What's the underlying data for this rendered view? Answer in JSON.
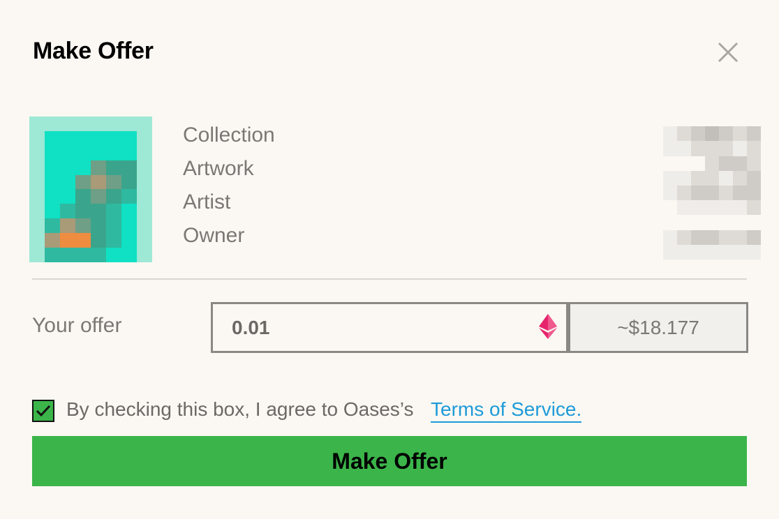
{
  "modal": {
    "title": "Make Offer",
    "close_icon": "close-icon"
  },
  "details": {
    "labels": [
      "Collection",
      "Artwork",
      "Artist",
      "Owner"
    ]
  },
  "offer": {
    "label": "Your offer",
    "value": "0.01",
    "currency_icon": "ethereum-icon",
    "usd_estimate": "~$18.177"
  },
  "terms": {
    "checked": true,
    "text": "By checking this box, I agree to Oases’s",
    "link_text": "Terms of Service."
  },
  "submit": {
    "label": "Make Offer"
  },
  "colors": {
    "background": "#fbf8f3",
    "accent_green": "#3bb54a",
    "link_blue": "#1d9bd8",
    "eth_pink": "#e6236d"
  }
}
